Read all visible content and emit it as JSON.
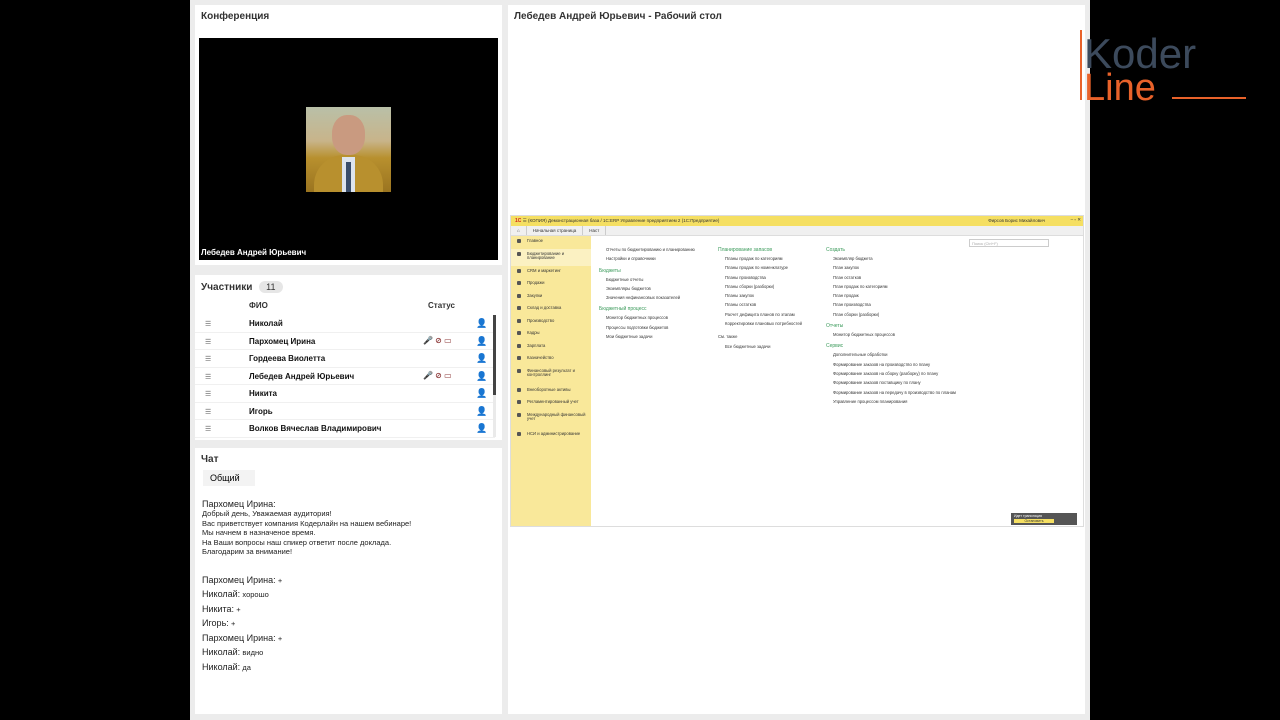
{
  "conference": {
    "title": "Конференция",
    "video_name": "Лебедев Андрей Юрьевич"
  },
  "participants": {
    "title": "Участники",
    "count": "11",
    "col_name": "ФИО",
    "col_status": "Статус",
    "rows": [
      {
        "name": "Николай",
        "icons": ""
      },
      {
        "name": "Пархомец Ирина",
        "icons": "🎤 ⊘ ▭"
      },
      {
        "name": "Гордеева Виолетта",
        "icons": ""
      },
      {
        "name": "Лебедев Андрей Юрьевич",
        "icons": "🎤 ⊘ ▭"
      },
      {
        "name": "Никита",
        "icons": ""
      },
      {
        "name": "Игорь",
        "icons": ""
      },
      {
        "name": "Волков Вячеслав Владимирович",
        "icons": ""
      }
    ]
  },
  "chat": {
    "title": "Чат",
    "tab": "Общий",
    "first": {
      "who": "Пархомец Ирина:",
      "text": "Добрый день, Уважаемая аудитория!\nВас приветствует компания Кодерлайн на нашем вебинаре!\nМы начнем в назначеное время.\nНа Ваши вопросы наш спикер ответит после доклада.\nБлагодарим за внимание!"
    },
    "messages": [
      {
        "who": "Пархомец Ирина:",
        "text": "+"
      },
      {
        "who": "Николай:",
        "text": "хорошо"
      },
      {
        "who": "Никита:",
        "text": "+"
      },
      {
        "who": "Игорь:",
        "text": "+"
      },
      {
        "who": "Пархомец Ирина:",
        "text": "+"
      },
      {
        "who": "Николай:",
        "text": "видно"
      },
      {
        "who": "Николай:",
        "text": "да"
      }
    ]
  },
  "desktop": {
    "title": "Лебедев Андрей Юрьевич - Рабочий стол",
    "app": {
      "logo": "1С",
      "window_title": "(КОПИЯ) Демонстрационная база / 1С:ERP Управление предприятием 2  (1С:Предприятие)",
      "user": "Фирсов Борис Михайлович",
      "tabs": [
        "Начальная страница",
        "Наст"
      ],
      "search_placeholder": "Поиск (Ctrl+F)",
      "sidebar": [
        "Главное",
        "Бюджетирование и планирование",
        "CRM и маркетинг",
        "Продажи",
        "Закупки",
        "Склад и доставка",
        "Производство",
        "Кадры",
        "Зарплата",
        "Казначейство",
        "Финансовый результат и контроллинг",
        "Внеоборотные активы",
        "Регламентированный учет",
        "Международный финансовый учет",
        "НСИ и администрирование"
      ],
      "col1": {
        "top": [
          "Отчеты по бюджетированию и планированию",
          "Настройки и справочники"
        ],
        "group1_title": "Бюджеты",
        "group1": [
          "Бюджетные отчеты",
          "Экземпляры бюджетов",
          "Значения нефинансовых показателей"
        ],
        "group2_title": "Бюджетный процесс",
        "group2": [
          "Монитор бюджетных процессов",
          "Процессы подготовки бюджетов",
          "Мои бюджетные задачи"
        ]
      },
      "col2": {
        "title": "Планирование запасов",
        "items": [
          "Планы продаж по категориям",
          "Планы продаж по номенклатуре",
          "Планы производства",
          "Планы сборки (разборки)",
          "Планы закупок",
          "Планы остатков",
          "Расчет дефицита планов по этапам",
          "Корректировки плановых потребностей"
        ],
        "see_also": "См. также",
        "see_items": [
          "Все бюджетные задачи"
        ]
      },
      "col3": {
        "create_title": "Создать",
        "create": [
          "Экземпляр бюджета",
          "План закупок",
          "План остатков",
          "План продаж по категориям",
          "План продаж",
          "План производства",
          "План сборки (разборки)"
        ],
        "reports_title": "Отчеты",
        "reports": [
          "Монитор бюджетных процессов"
        ],
        "service_title": "Сервис",
        "service": [
          "Дополнительные обработки",
          "Формирование заказов на производство по плану",
          "Формирование заказов на сборку (разборку) по плану",
          "Формирование заказов поставщику по плану",
          "Формирование заказов на передачу в производство по планам",
          "Управление процессом планирования"
        ]
      },
      "popup_title": "Идет трансляция",
      "popup_button": "Остановить"
    }
  },
  "brand": {
    "logo_top": "Koder",
    "logo_bottom": "Line",
    "accent": "#e8622a",
    "dark": "#3c4a5c"
  }
}
